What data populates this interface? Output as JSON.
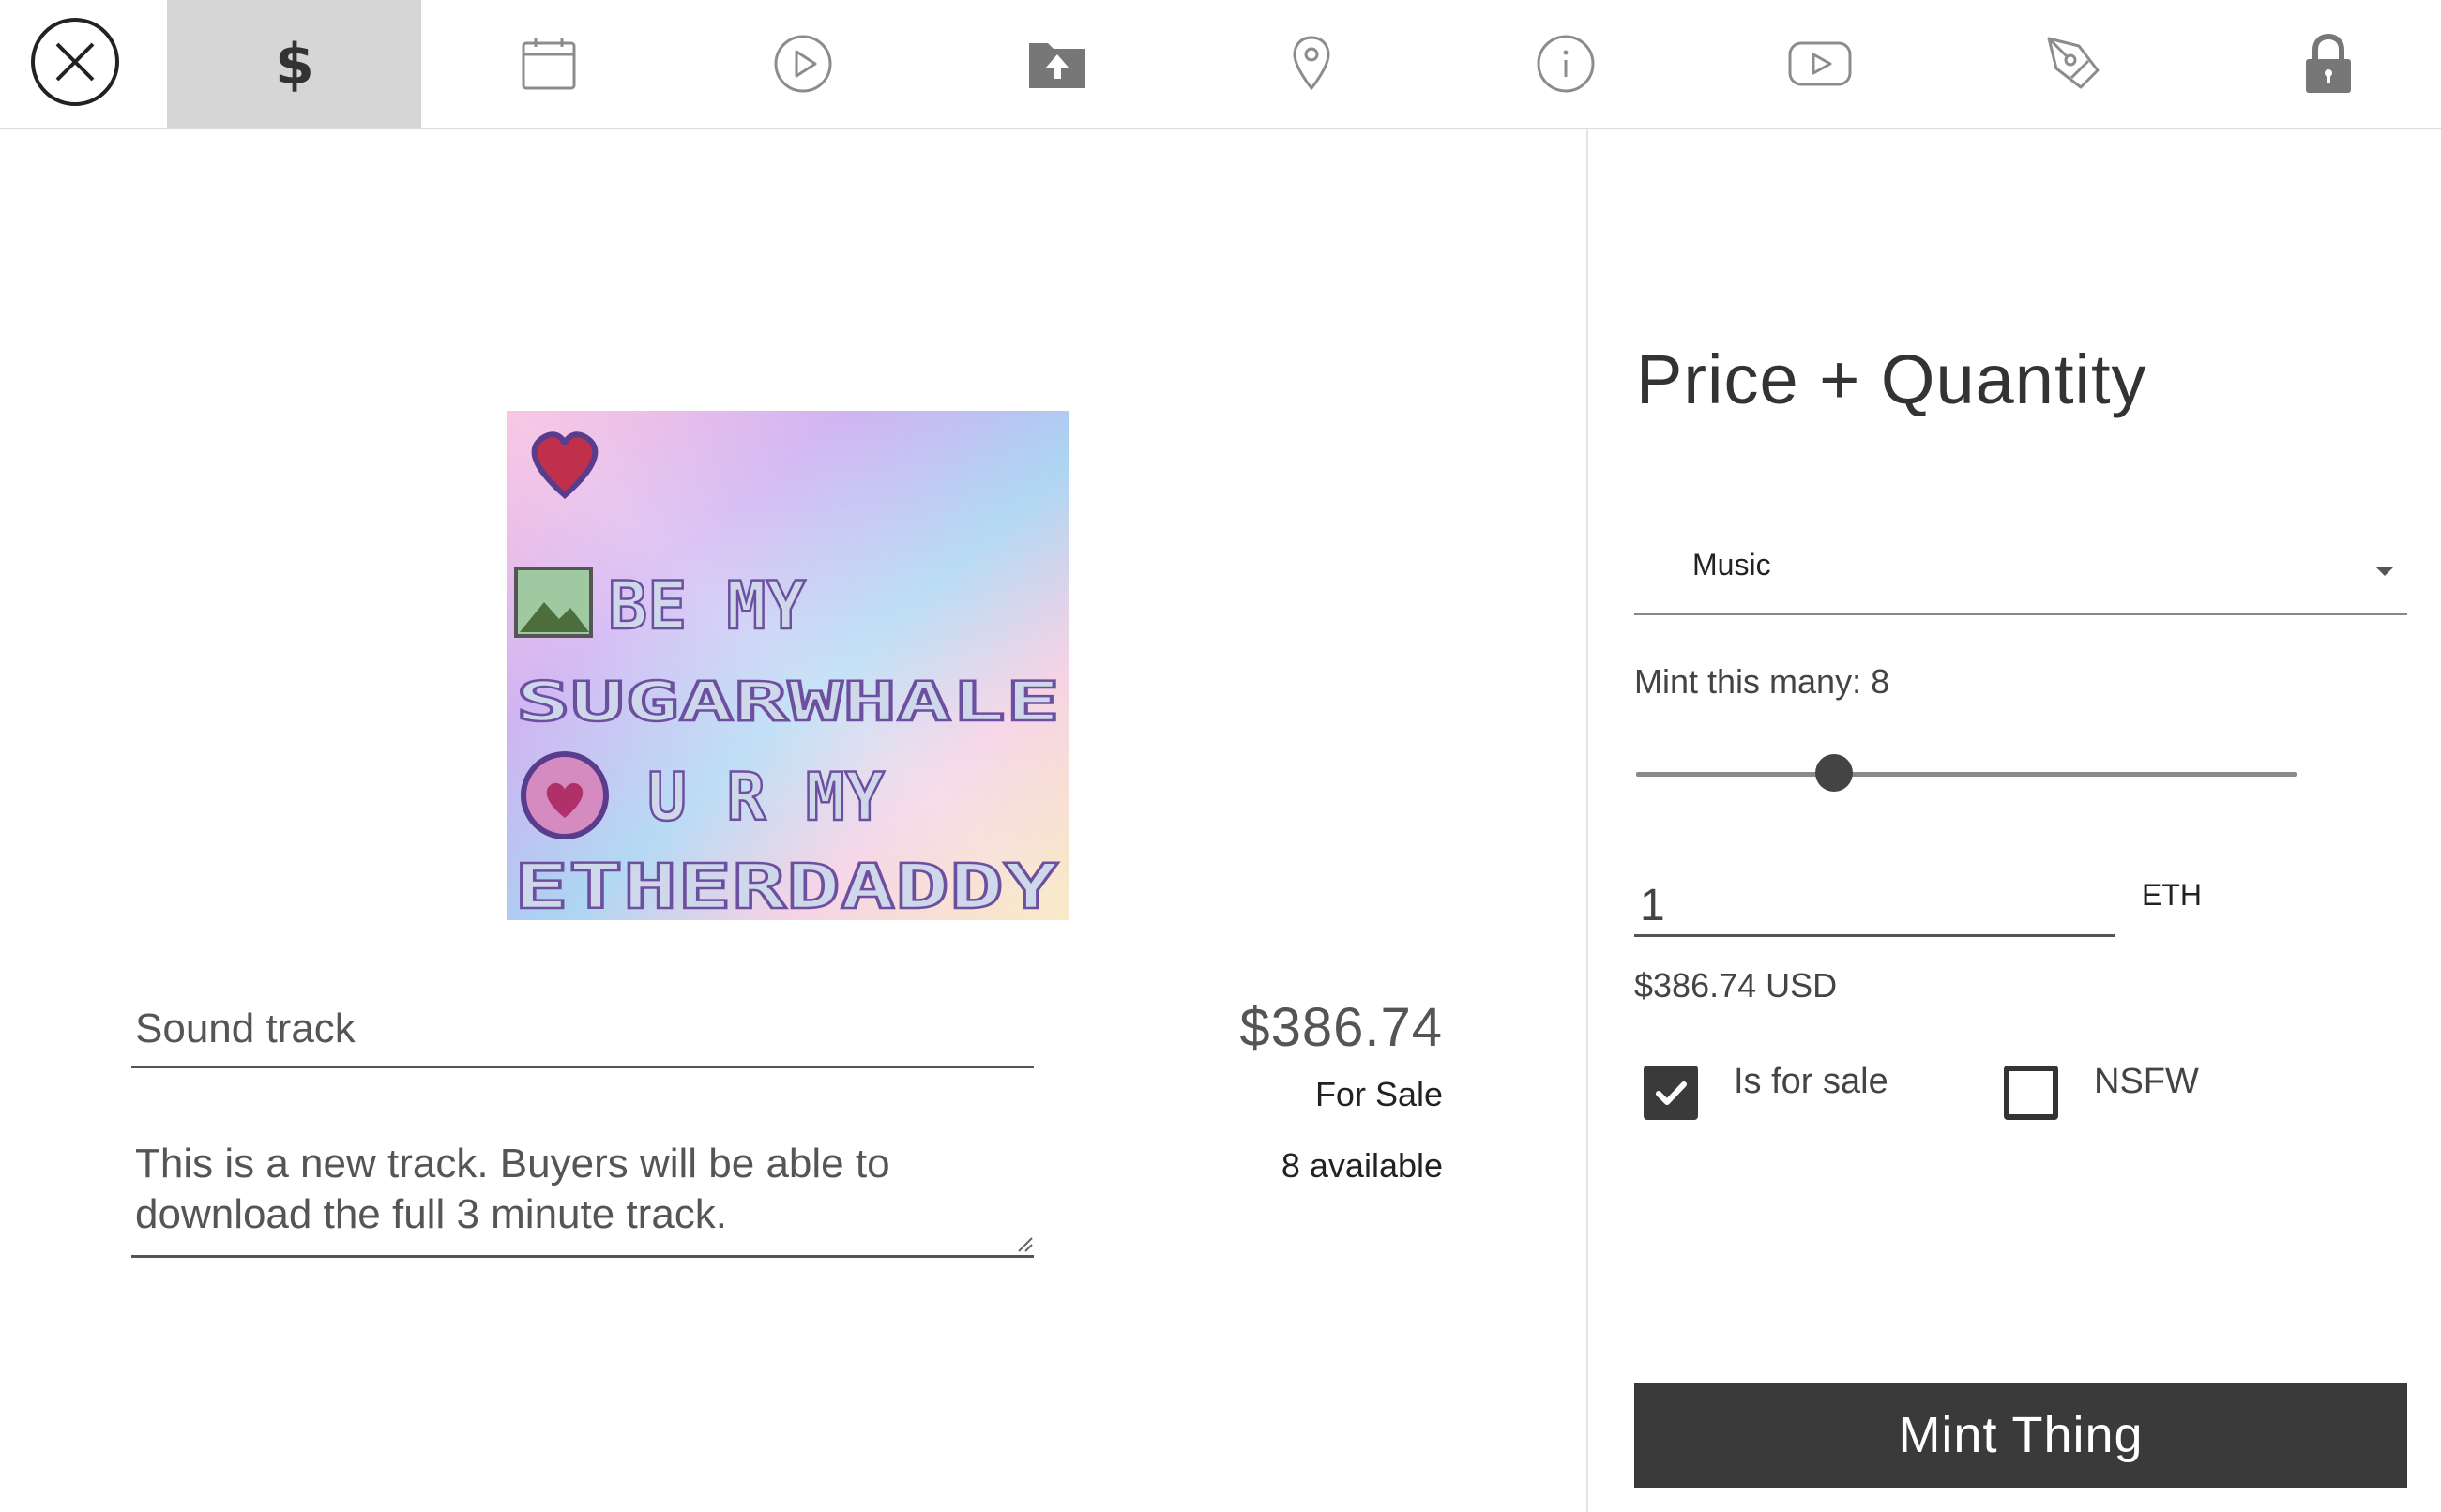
{
  "toolbar": {
    "close_icon": "close-circle-icon",
    "tabs": [
      {
        "icon": "dollar-icon",
        "active": true
      },
      {
        "icon": "calendar-icon",
        "active": false
      },
      {
        "icon": "play-circle-icon",
        "active": false
      },
      {
        "icon": "folder-upload-icon",
        "active": false
      },
      {
        "icon": "location-pin-icon",
        "active": false
      },
      {
        "icon": "info-icon",
        "active": false
      },
      {
        "icon": "youtube-icon",
        "active": false
      },
      {
        "icon": "pen-tool-icon",
        "active": false
      },
      {
        "icon": "lock-icon",
        "active": false
      }
    ]
  },
  "preview": {
    "artwork_lines": [
      "BE MY",
      "SUGARWHALE",
      "U R MY",
      "ETHERDADDY"
    ],
    "title_value": "Sound track",
    "description_value": "This is a new track. Buyers will be able to download the full 3 minute track.",
    "price": "$386.74",
    "status": "For Sale",
    "available": "8 available"
  },
  "panel": {
    "title": "Price + Quantity",
    "category_selected": "Music",
    "mint_label": "Mint this many: 8",
    "mint_slider_fraction": 0.3,
    "price_value": "1",
    "price_unit": "ETH",
    "usd_value": "$386.74 USD",
    "for_sale_label": "Is for sale",
    "for_sale_checked": true,
    "nsfw_label": "NSFW",
    "nsfw_checked": false,
    "mint_button_label": "Mint Thing"
  },
  "colors": {
    "active_tab": "#d6d6d6",
    "button_dark": "#3a3a3a",
    "icon_gray": "#8c8c8c"
  }
}
